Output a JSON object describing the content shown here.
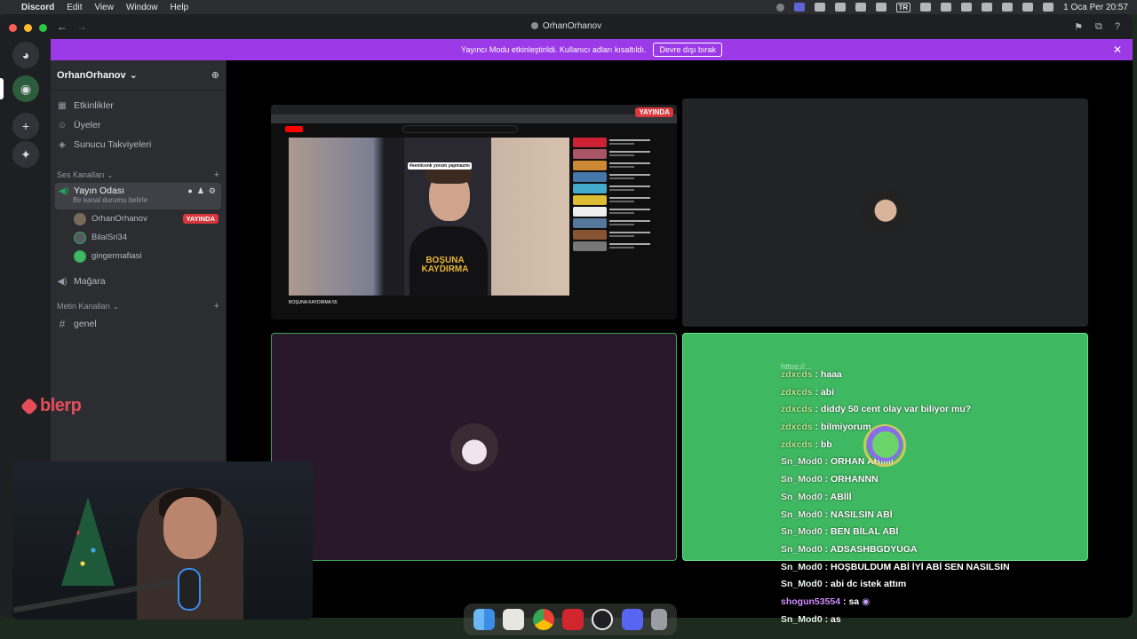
{
  "menubar": {
    "app_name": "Discord",
    "items": [
      "Edit",
      "View",
      "Window",
      "Help"
    ],
    "input_source": "TR",
    "clock": "1 Oca Per  20:57"
  },
  "window": {
    "title": "OrhanOrhanov"
  },
  "banner": {
    "text": "Yayıncı Modu etkinleştirildi. Kullanıcı adları kısaltıldı.",
    "button": "Devre dışı bırak",
    "close": "✕"
  },
  "sidebar": {
    "server_name": "OrhanOrhanov",
    "chevron": "⌄",
    "nav": [
      {
        "label": "Etkinlikler",
        "icon": "calendar-icon"
      },
      {
        "label": "Üyeler",
        "icon": "members-icon"
      },
      {
        "label": "Sunucu Takviyeleri",
        "icon": "boost-icon"
      }
    ],
    "voice_category": "Ses Kanalları",
    "voice_channel": {
      "name": "Yayın Odası",
      "status": "Bir kanal durumu belirle"
    },
    "voice_users": [
      {
        "name": "OrhanOrhanov",
        "live": "YAYINDA",
        "color": "#7a6a5c"
      },
      {
        "name": "BilalSri34",
        "live": "",
        "color": "#555b60"
      },
      {
        "name": "gingermafiasi",
        "live": "",
        "color": "#3fb862"
      }
    ],
    "store_channel": "Mağara",
    "text_category": "Metin Kanalları",
    "text_channel": "genel"
  },
  "stage": {
    "screen_live": "YAYINDA",
    "shared_screen": {
      "caption": "#semicenk yorum yapmazmı",
      "burned_text": "BOŞUNA KAYDIRMA",
      "video_title": "BOŞUNA KAYDIRMA 55"
    }
  },
  "chat": {
    "cut_line": "https://...",
    "messages": [
      {
        "user": "zdxcds",
        "text": "haaa",
        "kind": "user"
      },
      {
        "user": "zdxcds",
        "text": "abi",
        "kind": "user"
      },
      {
        "user": "zdxcds",
        "text": "diddy 50 cent olay var biliyor mu?",
        "kind": "user"
      },
      {
        "user": "zdxcds",
        "text": "bilmiyorum",
        "kind": "user"
      },
      {
        "user": "zdxcds",
        "text": "bb",
        "kind": "user"
      },
      {
        "user": "Sn_Mod0",
        "text": "ORHAN ABİİİİİ",
        "kind": "mod"
      },
      {
        "user": "Sn_Mod0",
        "text": "ORHANNN",
        "kind": "mod"
      },
      {
        "user": "Sn_Mod0",
        "text": "ABİİİ",
        "kind": "mod"
      },
      {
        "user": "Sn_Mod0",
        "text": "NASILSIN ABİ",
        "kind": "mod"
      },
      {
        "user": "Sn_Mod0",
        "text": "BEN BİLAL ABİ",
        "kind": "mod"
      },
      {
        "user": "Sn_Mod0",
        "text": "ADSASHBGDYUGA",
        "kind": "mod"
      },
      {
        "user": "Sn_Mod0",
        "text": "HOŞBULDUM ABİ İYİ ABİ SEN NASILSIN",
        "kind": "mod"
      },
      {
        "user": "Sn_Mod0",
        "text": "abi dc istek attım",
        "kind": "mod"
      },
      {
        "user": "shogun53554",
        "text": "sa",
        "kind": "pur"
      },
      {
        "user": "Sn_Mod0",
        "text": "as",
        "kind": "mod"
      }
    ]
  },
  "overlay": {
    "brand": "blerp"
  },
  "colors": {
    "accent": "#9b3ae6",
    "live": "#da373c",
    "speaking": "#3ba55c"
  }
}
